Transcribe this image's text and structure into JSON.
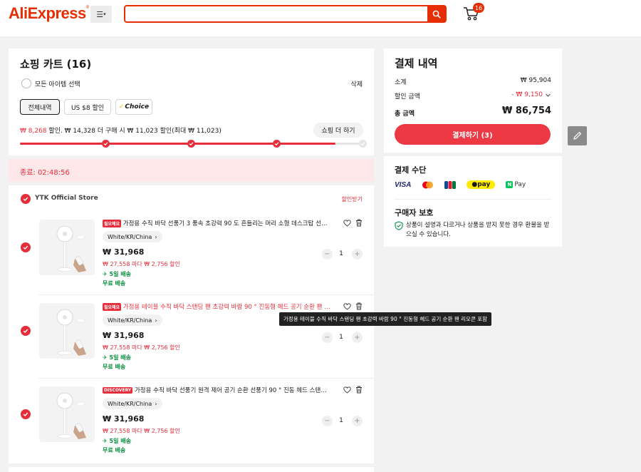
{
  "header": {
    "logo": "AliExpress",
    "logo_mark": "®",
    "search_placeholder": "",
    "cart_count": "16"
  },
  "cart": {
    "title": "쇼핑 카트 (16)",
    "select_all": "모든 아이템 선택",
    "delete": "삭제",
    "tabs": [
      "전체내역",
      "US $8 할인",
      "Choice"
    ],
    "promo_discount": "₩ 8,268",
    "promo_text": " 할인. ₩ 14,328 더 구매 시 ₩ 11,023 할인(최대 ₩ 11,023)",
    "shop_more": "쇼핑 더 하기",
    "progress": 0.92,
    "timer": "종료: 02:48:56"
  },
  "store": {
    "name": "YTK Official Store",
    "coupon": "할인받기",
    "items": [
      {
        "badge": "필요해요",
        "title": "가정용 수직 바닥 선풍기 3 풍속 초강력 90 도 흔들리는 머리 소형 데스크탑 선풍기",
        "variant": "White/KR/China",
        "price": "₩ 31,968",
        "promo": "₩ 27,558 마다 ₩ 2,756 할인",
        "delivery": "5일 배송",
        "free_ship": "무료 배송",
        "qty": "1",
        "title_red": false
      },
      {
        "badge": "필요해요",
        "title": "가정용 테이블 수직 바닥 스탠딩 팬 초강력 바람 90 ° 진동형 헤드 공기 순환 팬 리모콘 포함",
        "variant": "White/KR/China",
        "price": "₩ 31,968",
        "promo": "₩ 27,558 마다 ₩ 2,756 할인",
        "delivery": "5일 배송",
        "free_ship": "무료 배송",
        "qty": "1",
        "title_red": true
      },
      {
        "badge": "DISCOVERY",
        "title": "가정용 수직 바닥 선풍기 원격 제어 공기 순환 선풍기 90 ° 진동 헤드 스탠딩 선풍기",
        "variant": "White/KR/China",
        "price": "₩ 31,968",
        "promo": "₩ 27,558 마다 ₩ 2,756 할인",
        "delivery": "5일 배송",
        "free_ship": "무료 배송",
        "qty": "1",
        "title_red": false
      }
    ],
    "tooltip": "가정용 테이블 수직 바닥 스탠딩 팬 초강력 바람 90 ° 진동형 헤드 공기 순환 팬 리모콘 포함"
  },
  "summary": {
    "title": "결제 내역",
    "subtotal_label": "소계",
    "subtotal_value": "₩ 95,904",
    "discount_label": "할인 금액",
    "discount_value": "- ₩ 9,150",
    "total_label": "총 금액",
    "total_value": "₩ 86,754",
    "checkout": "결제하기 (3)"
  },
  "payment": {
    "title": "결제 수단",
    "methods": [
      "VISA",
      "Mastercard",
      "JCB",
      "pay",
      "Pay"
    ],
    "protection_title": "구매자 보호",
    "protection_text": "상품이 설명과 다르거나 상품을 받지 못한 경우 환불을 받으실 수 있습니다."
  },
  "colors": {
    "brand": "#e62e04",
    "accent": "#e62e3b",
    "ship_green": "#0a8f3f"
  }
}
